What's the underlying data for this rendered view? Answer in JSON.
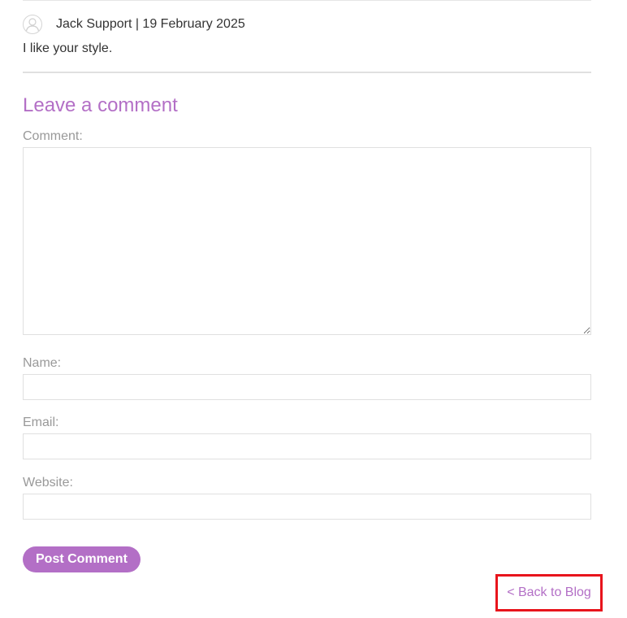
{
  "comment": {
    "author_meta": "Jack Support | 19 February 2025",
    "body": "I like your style."
  },
  "form": {
    "heading": "Leave a comment",
    "comment_label": "Comment:",
    "comment_value": "",
    "name_label": "Name:",
    "name_value": "",
    "email_label": "Email:",
    "email_value": "",
    "website_label": "Website:",
    "website_value": "",
    "submit_label": "Post Comment"
  },
  "nav": {
    "back_label": "< Back to Blog"
  },
  "icons": {
    "avatar": "user-avatar-icon"
  },
  "colors": {
    "accent": "#b36fc6",
    "highlight_box": "#e8141c",
    "label_gray": "#999999",
    "text": "#333333"
  }
}
